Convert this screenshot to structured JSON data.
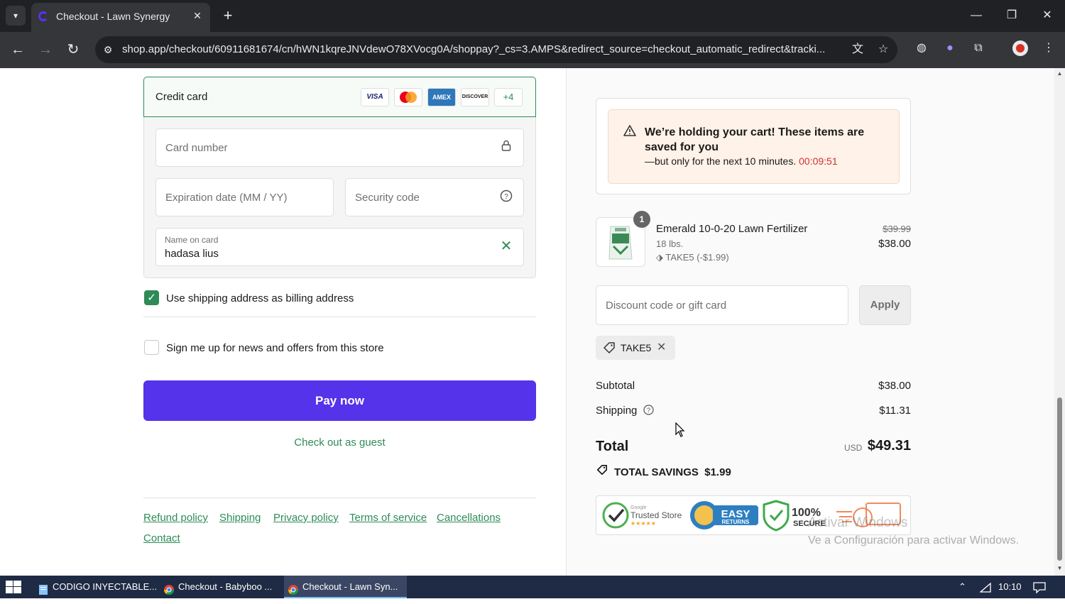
{
  "browser": {
    "tab_title": "Checkout - Lawn Synergy",
    "url": "shop.app/checkout/60911681674/cn/hWN1kqreJNVdewO78XVocg0A/shoppay?_cs=3.AMPS&redirect_source=checkout_automatic_redirect&tracki...",
    "new_tab": "+",
    "close": "✕"
  },
  "payment": {
    "method_label": "Credit card",
    "card_brands": [
      "VISA",
      "MC",
      "AMEX",
      "DISCOVER"
    ],
    "more_brands": "+4",
    "card_number_placeholder": "Card number",
    "expiration_placeholder": "Expiration date (MM / YY)",
    "security_placeholder": "Security code",
    "name_label": "Name on card",
    "name_value": "hadasa lius"
  },
  "options": {
    "billing_same": "Use shipping address as billing address",
    "newsletter": "Sign me up for news and offers from this store"
  },
  "actions": {
    "pay_now": "Pay now",
    "guest": "Check out as guest"
  },
  "footer_links": [
    "Refund policy",
    "Shipping",
    "Privacy policy",
    "Terms of service",
    "Cancellations",
    "Contact"
  ],
  "hold_notice": {
    "title": "We’re holding your cart! These items are saved for you",
    "subtitle": "—but only for the next 10 minutes.",
    "timer": "00:09:51"
  },
  "product": {
    "quantity": "1",
    "name": "Emerald 10-0-20 Lawn Fertilizer",
    "variant": "18 lbs.",
    "discount": "TAKE5 (-$1.99)",
    "original_price": "$39.99",
    "price": "$38.00"
  },
  "discount": {
    "placeholder": "Discount code or gift card",
    "apply": "Apply",
    "applied_code": "TAKE5"
  },
  "summary": {
    "subtotal_label": "Subtotal",
    "subtotal_value": "$38.00",
    "shipping_label": "Shipping",
    "shipping_value": "$11.31",
    "total_label": "Total",
    "currency": "USD",
    "total_value": "$49.31",
    "savings_label": "TOTAL SAVINGS",
    "savings_value": "$1.99"
  },
  "trust_badges": {
    "trusted_store_small": "Google",
    "trusted_store": "Trusted Store",
    "stars": "★★★★★",
    "easy": "EASY",
    "returns": "RETURNS",
    "secure_pct": "100%",
    "secure": "SECURE"
  },
  "watermark": {
    "line1": "Activar Windows",
    "line2": "Ve a Configuración para activar Windows."
  },
  "taskbar": {
    "items": [
      "CODIGO INYECTABLE...",
      "Checkout - Babyboo ...",
      "Checkout - Lawn Syn..."
    ],
    "time": "10:10"
  },
  "colors": {
    "accent_green": "#2e8b57",
    "pay_button": "#5433eb",
    "timer_red": "#d32f2f"
  }
}
